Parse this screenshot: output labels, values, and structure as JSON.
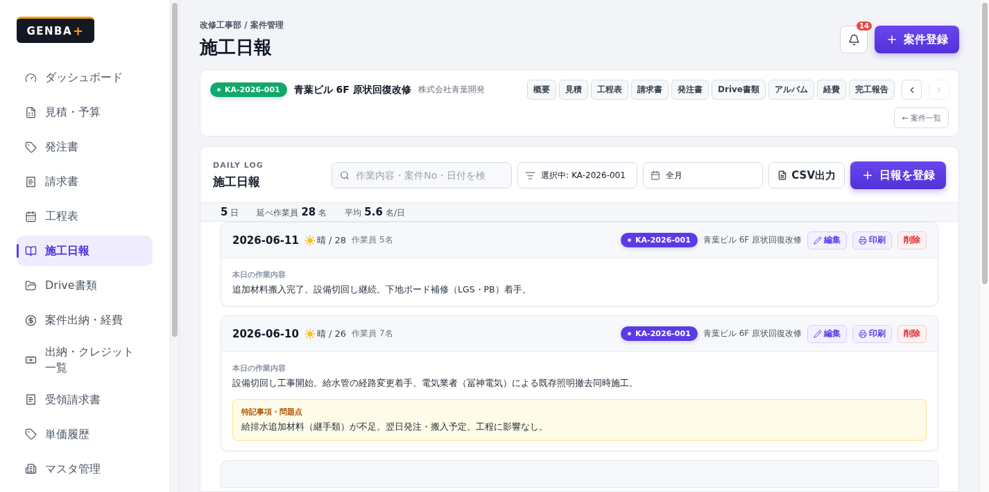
{
  "sidebar": {
    "logo": {
      "text": "GENBA",
      "mark": "+"
    },
    "items": [
      {
        "label": "ダッシュボード",
        "selected": false
      },
      {
        "label": "見積・予算",
        "selected": false
      },
      {
        "label": "発注書",
        "selected": false
      },
      {
        "label": "請求書",
        "selected": false
      },
      {
        "label": "工程表",
        "selected": false
      },
      {
        "label": "施工日報",
        "selected": true
      },
      {
        "label": "Drive書類",
        "selected": false
      },
      {
        "label": "案件出納・経費",
        "selected": false
      },
      {
        "label": "出納・クレジット一覧",
        "selected": false
      },
      {
        "label": "受領請求書",
        "selected": false
      },
      {
        "label": "単価履歴",
        "selected": false
      },
      {
        "label": "マスタ管理",
        "selected": false
      }
    ]
  },
  "header": {
    "breadcrumb": "改修工事部 / 案件管理",
    "title": "施工日報",
    "notifications": "14",
    "primary_button": "案件登録"
  },
  "project": {
    "code": "KA-2026-001",
    "name": "青葉ビル 6F 原状回復改修",
    "client": "株式会社青葉開発",
    "tabs": [
      "概要",
      "見積",
      "工程表",
      "請求書",
      "発注書",
      "Drive書類",
      "アルバム",
      "経費",
      "完工報告"
    ],
    "prev_disabled": false,
    "next_disabled": true,
    "back_link": "← 案件一覧"
  },
  "daily_log": {
    "eyebrow": "DAILY LOG",
    "title": "施工日報",
    "search": {
      "placeholder": "作業内容・案件No・日付を検"
    },
    "filter": "選択中: KA-2026-001",
    "period": "全月",
    "csv_button": "CSV出力",
    "add_button": "日報を登録",
    "stats": [
      {
        "value": "5",
        "unit": "日"
      },
      {
        "label": "延べ作業員",
        "value": "28",
        "unit": "名"
      },
      {
        "label": "平均",
        "value": "5.6",
        "unit": "名/日"
      }
    ],
    "entries": [
      {
        "date": "2026-06-11",
        "weather": "晴 / 28",
        "workers": "作業員 5名",
        "code": "KA-2026-001",
        "project": "青葉ビル 6F 原状回復改修",
        "edit": "編集",
        "print": "印刷",
        "delete": "削除",
        "work_label": "本日の作業内容",
        "work": "追加材料搬入完了。設備切回し継続。下地ボード補修（LGS・PB）着手。"
      },
      {
        "date": "2026-06-10",
        "weather": "晴 / 26",
        "workers": "作業員 7名",
        "code": "KA-2026-001",
        "project": "青葉ビル 6F 原状回復改修",
        "edit": "編集",
        "print": "印刷",
        "delete": "削除",
        "work_label": "本日の作業内容",
        "work": "設備切回し工事開始。給水管の経路変更着手。電気業者（冨神電気）による既存照明撤去同時施工。",
        "note_label": "特記事項・問題点",
        "note": "給排水追加材料（継手類）が不足。翌日発注・搬入予定。工程に影響なし。"
      }
    ]
  }
}
